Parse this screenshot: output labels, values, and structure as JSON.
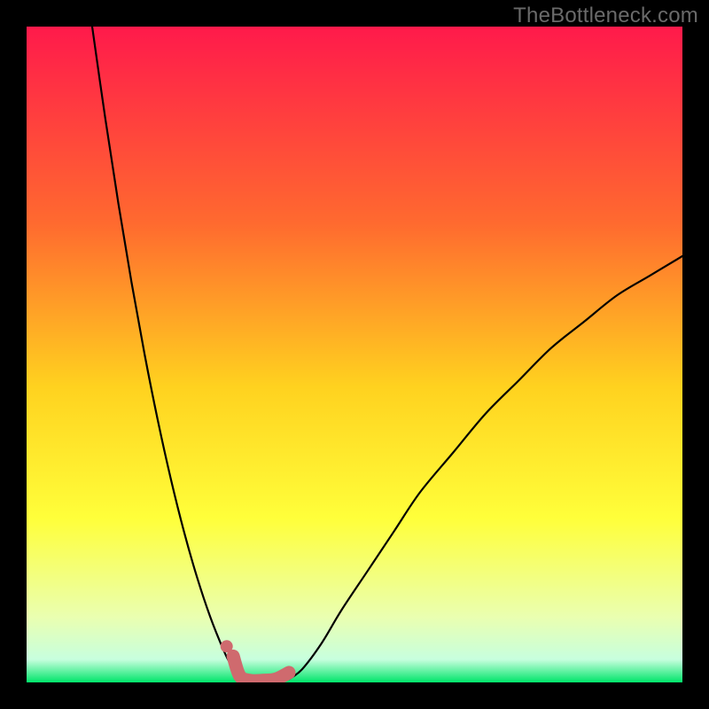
{
  "watermark": "TheBottleneck.com",
  "colors": {
    "background": "#000000",
    "watermark": "#6a6a6a",
    "curve_black": "#000000",
    "curve_pink": "#cf6a6e",
    "gradient_top": "#ff1a4b",
    "gradient_mid1": "#ff6a2f",
    "gradient_mid2": "#ffd21f",
    "gradient_mid3": "#ffff3a",
    "gradient_mid4": "#eaffb0",
    "gradient_green": "#00e56a"
  },
  "chart_data": {
    "type": "line",
    "title": "",
    "xlabel": "",
    "ylabel": "",
    "xlim": [
      0,
      100
    ],
    "ylim": [
      0,
      100
    ],
    "series": [
      {
        "name": "left-branch",
        "x": [
          10,
          12,
          14,
          16,
          18,
          20,
          22,
          24,
          26,
          28,
          30,
          31,
          32,
          33,
          34
        ],
        "y": [
          100,
          86,
          73,
          61,
          50,
          40,
          31,
          23,
          16,
          10,
          5,
          3,
          2,
          1,
          0.5
        ],
        "color": "#000000",
        "weight": "thin"
      },
      {
        "name": "right-branch",
        "x": [
          40,
          42,
          45,
          48,
          52,
          56,
          60,
          65,
          70,
          75,
          80,
          85,
          90,
          95,
          100
        ],
        "y": [
          0.5,
          2,
          6,
          11,
          17,
          23,
          29,
          35,
          41,
          46,
          51,
          55,
          59,
          62,
          65
        ],
        "color": "#000000",
        "weight": "thin"
      },
      {
        "name": "valley-highlight",
        "x": [
          31.5,
          32.5,
          34,
          36,
          38,
          40
        ],
        "y": [
          4,
          1,
          0.3,
          0.3,
          0.5,
          1.5
        ],
        "color": "#cf6a6e",
        "weight": "thick"
      },
      {
        "name": "highlight-dot",
        "x": [
          30.5
        ],
        "y": [
          5.5
        ],
        "color": "#cf6a6e",
        "weight": "dot"
      }
    ],
    "background_gradient_stops": [
      {
        "offset": 0.0,
        "color": "#ff1a4b"
      },
      {
        "offset": 0.3,
        "color": "#ff6a2f"
      },
      {
        "offset": 0.55,
        "color": "#ffd21f"
      },
      {
        "offset": 0.75,
        "color": "#ffff3a"
      },
      {
        "offset": 0.9,
        "color": "#eaffb0"
      },
      {
        "offset": 0.965,
        "color": "#c7ffde"
      },
      {
        "offset": 1.0,
        "color": "#00e56a"
      }
    ]
  }
}
